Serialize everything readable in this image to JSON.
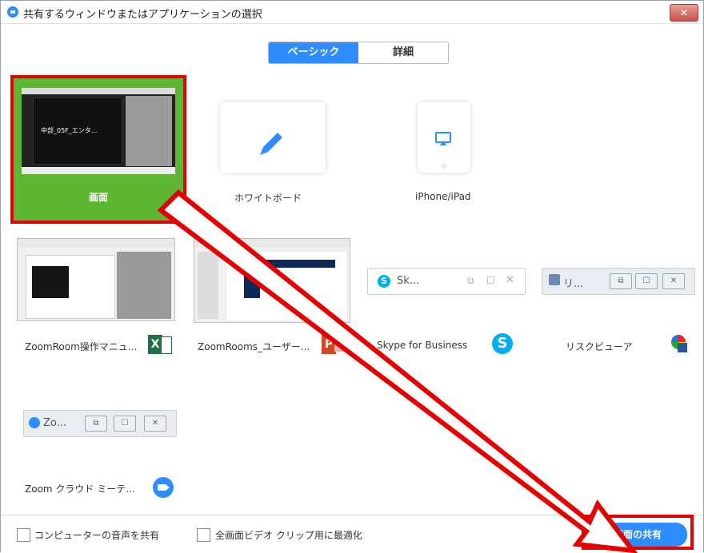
{
  "window": {
    "title": "共有するウィンドウまたはアプリケーションの選択",
    "close_label": "✕"
  },
  "tabs": [
    {
      "label": "ベーシック",
      "active": true
    },
    {
      "label": "詳細",
      "active": false
    }
  ],
  "items": {
    "screen": {
      "caption": "画面",
      "thumb_text": "中部_05F_エンタ..."
    },
    "whiteboard": {
      "caption": "ホワイトボード"
    },
    "iphone": {
      "caption": "iPhone/iPad"
    },
    "excel": {
      "caption": "ZoomRoom操作マニュ...",
      "app_badge": "X"
    },
    "ppt": {
      "caption": "ZoomRooms_ユーザー...",
      "app_badge": "P"
    },
    "skype": {
      "caption": "Skype for Business",
      "bar_text": "Sk...",
      "app_badge": "S"
    },
    "risk": {
      "caption": "リスクビューア",
      "bar_text": "リ..."
    },
    "zoom": {
      "caption": "Zoom クラウド ミーテ...",
      "bar_text": "Zo..."
    }
  },
  "footer": {
    "option_audio": "コンピューターの音声を共有",
    "option_video": "全画面ビデオ クリップ用に最適化",
    "share_button": "画面の共有"
  },
  "colors": {
    "accent": "#2d8cff",
    "highlight": "#e60000",
    "selected_tile": "#5db531"
  }
}
